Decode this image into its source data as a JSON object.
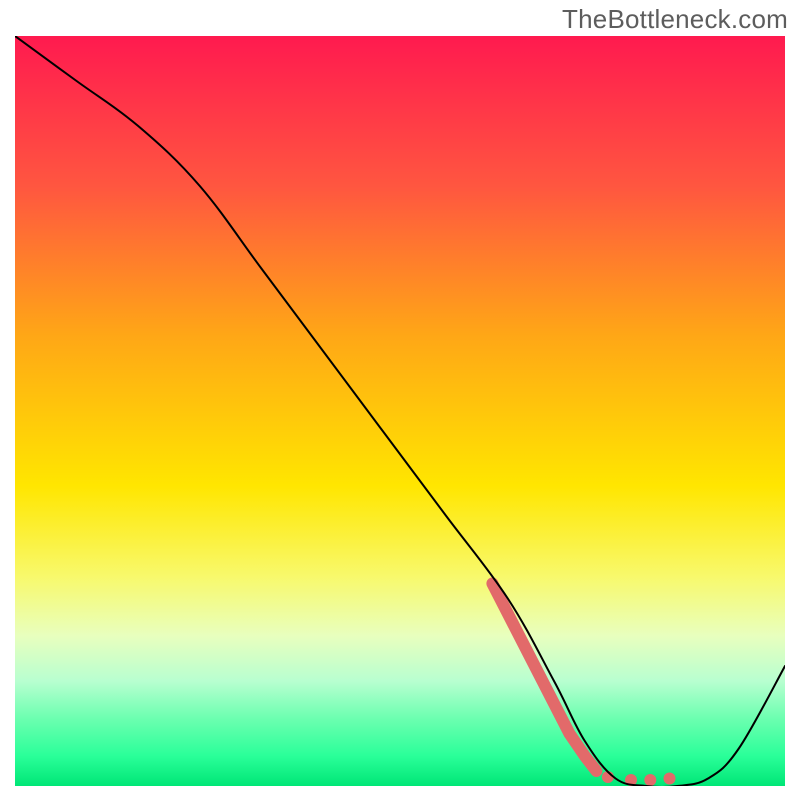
{
  "watermark": "TheBottleneck.com",
  "chart_data": {
    "type": "line",
    "title": "",
    "xlabel": "",
    "ylabel": "",
    "xlim": [
      0,
      100
    ],
    "ylim": [
      0,
      100
    ],
    "background_gradient": {
      "stops": [
        {
          "offset": 0.0,
          "color": "#ff1a4f"
        },
        {
          "offset": 0.2,
          "color": "#ff5640"
        },
        {
          "offset": 0.4,
          "color": "#ffa716"
        },
        {
          "offset": 0.6,
          "color": "#ffe600"
        },
        {
          "offset": 0.72,
          "color": "#f8f96b"
        },
        {
          "offset": 0.8,
          "color": "#e8ffbe"
        },
        {
          "offset": 0.86,
          "color": "#b8ffd0"
        },
        {
          "offset": 0.91,
          "color": "#6cffb0"
        },
        {
          "offset": 0.96,
          "color": "#2aff99"
        },
        {
          "offset": 1.0,
          "color": "#00e676"
        }
      ]
    },
    "series": [
      {
        "name": "curve",
        "color": "#000000",
        "stroke_width": 2,
        "x": [
          0,
          8,
          16,
          24,
          32,
          40,
          48,
          56,
          64,
          70,
          74,
          78,
          82,
          86,
          90,
          94,
          100
        ],
        "y": [
          100,
          94,
          88,
          80,
          69,
          58,
          47,
          36,
          25,
          14,
          6,
          1,
          0,
          0,
          1,
          5,
          16
        ]
      }
    ],
    "highlight": {
      "name": "highlight-band",
      "color": "#e26a6a",
      "stroke_width": 12,
      "linecap": "round",
      "x": [
        62,
        64,
        66,
        68,
        70,
        72,
        74,
        75.5
      ],
      "y": [
        27,
        23,
        19,
        15,
        11,
        7,
        4,
        2
      ]
    },
    "highlight_dots": {
      "name": "highlight-dots",
      "color": "#e26a6a",
      "radius": 6,
      "x": [
        77,
        80,
        82.5,
        85
      ],
      "y": [
        1.2,
        0.8,
        0.8,
        1.0
      ]
    }
  }
}
